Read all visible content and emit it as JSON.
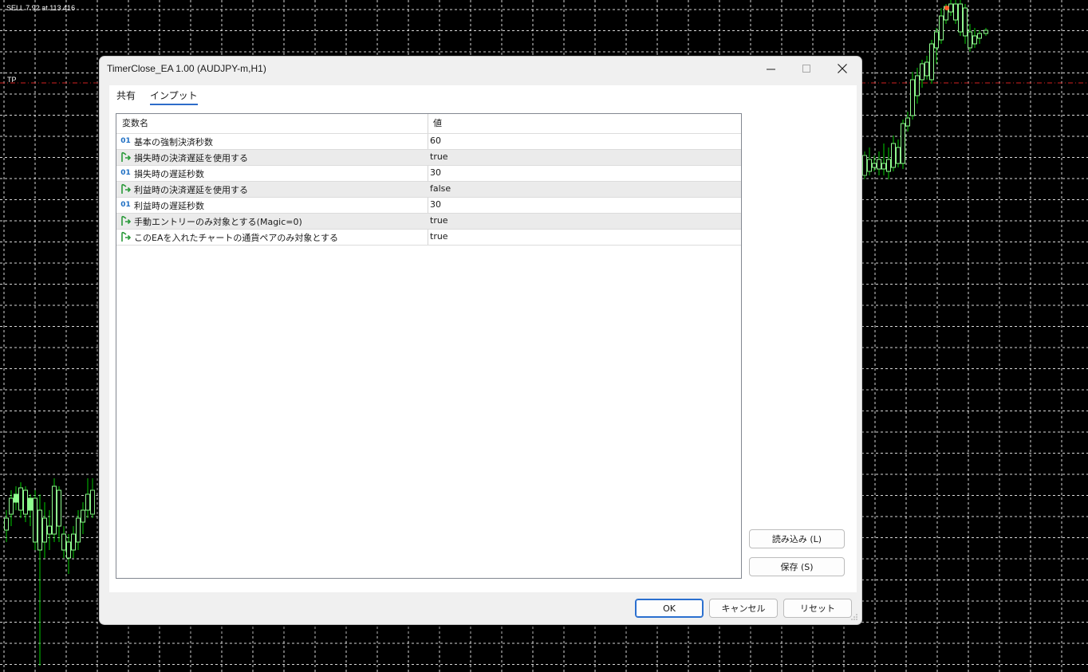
{
  "chart": {
    "order_label": "SELL 7.92 at 113.416",
    "tp_label": "TP",
    "colors": {
      "background": "#000000",
      "grid": "#ffffff",
      "candle": "#90ff90",
      "wick": "#00cc00",
      "tp_line": "#d22020"
    }
  },
  "dialog": {
    "title": "TimerClose_EA 1.00 (AUDJPY-m,H1)",
    "icons": {
      "minimize": "minimize-icon",
      "maximize": "maximize-icon",
      "close": "close-icon"
    },
    "tabs": [
      "共有",
      "インプット"
    ],
    "active_tab": "インプット",
    "table": {
      "headers": {
        "name": "変数名",
        "value": "値"
      },
      "rows": [
        {
          "type": "number",
          "icon_text": "01",
          "name": "基本の強制決済秒数",
          "value": "60"
        },
        {
          "type": "bool",
          "name": "損失時の決済遅延を使用する",
          "value": "true"
        },
        {
          "type": "number",
          "icon_text": "01",
          "name": "損失時の遅延秒数",
          "value": "30"
        },
        {
          "type": "bool",
          "name": "利益時の決済遅延を使用する",
          "value": "false"
        },
        {
          "type": "number",
          "icon_text": "01",
          "name": "利益時の遅延秒数",
          "value": "30"
        },
        {
          "type": "bool",
          "name": "手動エントリーのみ対象とする(Magic=0)",
          "value": "true"
        },
        {
          "type": "bool",
          "name": "このEAを入れたチャートの通貨ペアのみ対象とする",
          "value": "true"
        }
      ]
    },
    "buttons": {
      "load": "読み込み (L)",
      "save": "保存 (S)",
      "ok": "OK",
      "cancel": "キャンセル",
      "reset": "リセット"
    }
  }
}
